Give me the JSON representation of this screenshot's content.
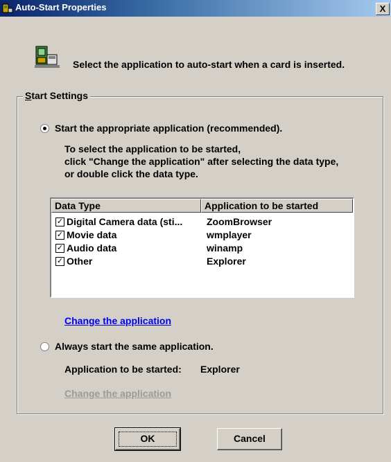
{
  "window": {
    "title": "Auto-Start Properties",
    "close_label": "X"
  },
  "instruction": "Select the application to auto-start when a card is inserted.",
  "start_settings": {
    "group_label": "Start Settings",
    "option1": {
      "label": "Start the appropriate application (recommended).",
      "selected": true,
      "help_lines": [
        "To select the application to be started,",
        "click \"Change the application\" after selecting the data type,",
        "or double click the data type."
      ]
    },
    "list": {
      "headers": [
        "Data Type",
        "Application to be started"
      ],
      "rows": [
        {
          "data_type": "Digital Camera data (sti...",
          "application": "ZoomBrowser",
          "checked": true
        },
        {
          "data_type": "Movie data",
          "application": "wmplayer",
          "checked": true
        },
        {
          "data_type": "Audio data",
          "application": "winamp",
          "checked": true
        },
        {
          "data_type": "Other",
          "application": "Explorer",
          "checked": true
        }
      ]
    },
    "change_link_1": "Change the application",
    "option2": {
      "label": "Always start the same application.",
      "selected": false,
      "app_label": "Application to be started:",
      "app_value": "Explorer"
    },
    "change_link_2": "Change the application"
  },
  "buttons": {
    "ok": "OK",
    "cancel": "Cancel"
  },
  "colors": {
    "link_active": "#0000ee",
    "link_disabled": "#9a9a9a",
    "title_bar": "#0a246a"
  }
}
